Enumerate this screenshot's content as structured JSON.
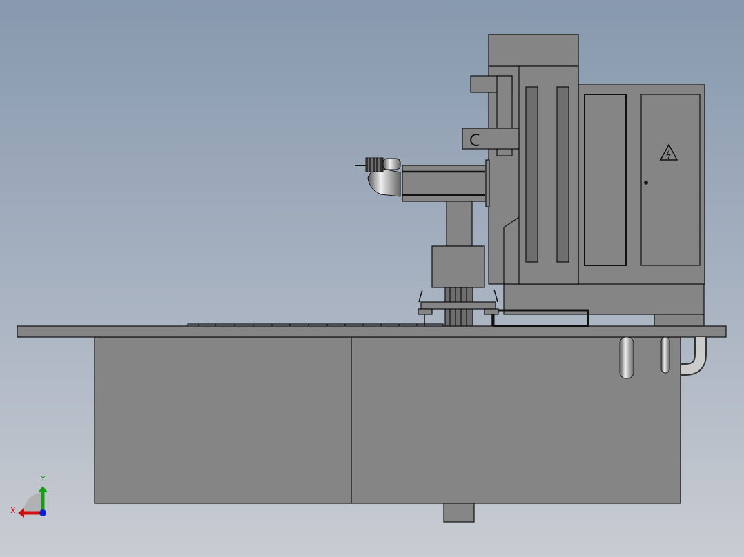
{
  "viewport": {
    "model": "machine-side-view"
  },
  "triad": {
    "x_label": "X",
    "y_label": "Y"
  },
  "colors": {
    "x_axis": "#d01010",
    "y_axis": "#10a010",
    "z_axis": "#1020d0",
    "body": "#858585"
  }
}
